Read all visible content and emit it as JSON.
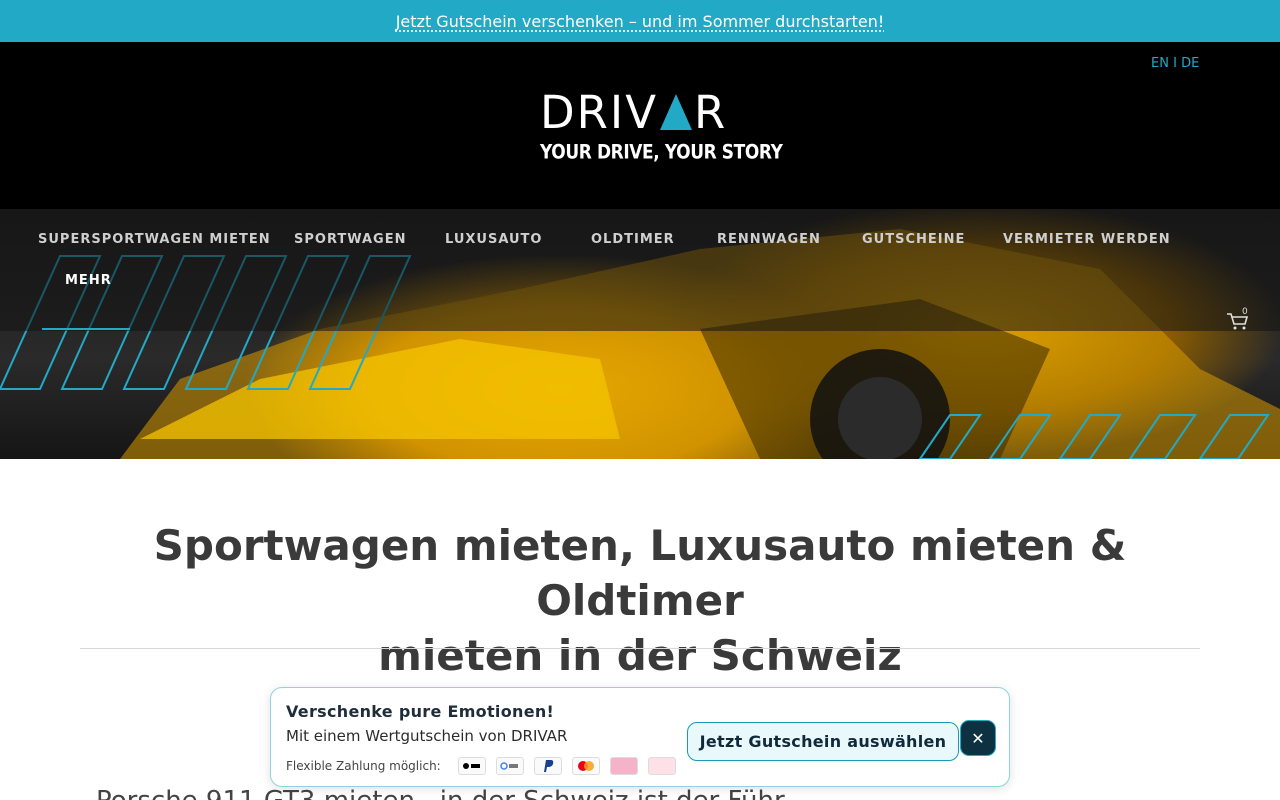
{
  "promo": {
    "text": "Jetzt Gutschein verschenken – und im Sommer durchstarten!"
  },
  "header": {
    "lang_en": "EN",
    "lang_sep": " I ",
    "lang_de": "DE",
    "logo_word_left": "DRIV",
    "logo_word_right": "R",
    "logo_tagline": "YOUR DRIVE, YOUR STORY"
  },
  "nav": {
    "items": [
      {
        "label": "SUPERSPORTWAGEN MIETEN"
      },
      {
        "label": "SPORTWAGEN"
      },
      {
        "label": "LUXUSAUTO"
      },
      {
        "label": "OLDTIMER"
      },
      {
        "label": "RENNWAGEN"
      },
      {
        "label": "GUTSCHEINE"
      },
      {
        "label": "VERMIETER WERDEN"
      },
      {
        "label": "MEHR"
      }
    ],
    "active_item": "MEHR",
    "cart_count": "0"
  },
  "main": {
    "title_line1": "Sportwagen mieten, Luxusauto mieten & Oldtimer",
    "title_line2": "mieten in der Schweiz",
    "partial_text": "Porsche 911 GT3 mieten                                      , in der Schweiz ist der Führ"
  },
  "popup": {
    "title": "Verschenke pure Emotionen!",
    "subtitle": "Mit einem Wertgutschein von DRIVAR",
    "payment_label": "Flexible Zahlung möglich:",
    "payment_methods": [
      "Apple Pay",
      "Google Pay",
      "PayPal",
      "Mastercard",
      "Twint",
      "Klarna"
    ],
    "cta_label": "Jetzt Gutschein auswählen",
    "close_label": "✕"
  },
  "colors": {
    "accent": "#22a9c6",
    "header_bg": "#000000",
    "dark_button": "#0d3140"
  }
}
